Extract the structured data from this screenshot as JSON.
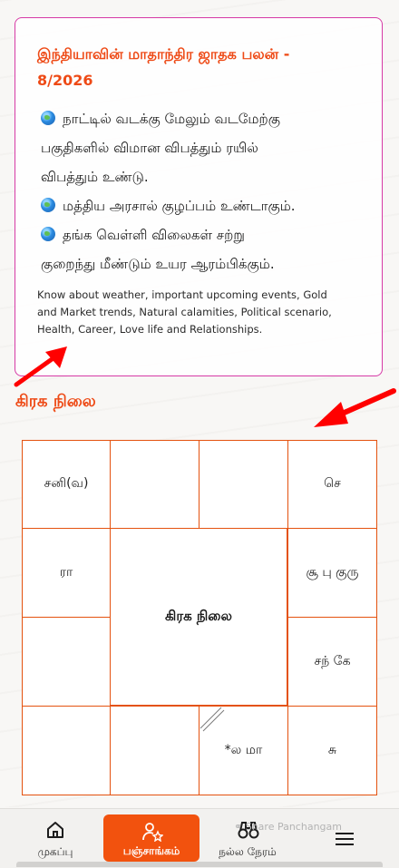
{
  "card": {
    "title_line1": "இந்தியாவின் மாதாந்திர ஜாதக பலன் -",
    "title_line2": "8/2026",
    "bullets": [
      {
        "icon": "globe-icon",
        "line1": "நாட்டில் வடக்கு மேலும் வடமேற்கு",
        "line2": "பகுதிகளில் விமான விபத்தும் ரயில்",
        "line3": "விபத்தும் உண்டு."
      },
      {
        "icon": "globe-icon",
        "line1": "மத்திய அரசால் குழப்பம் உண்டாகும்."
      },
      {
        "icon": "globe-icon",
        "line1": "தங்க வெள்ளி விலைகள் சற்று",
        "line2": "குறைந்து மீண்டும் உயர ஆரம்பிக்கும்."
      }
    ],
    "footer_line1": "Know about weather, important upcoming events, Gold",
    "footer_line2": "and Market trends, Natural calamities, Political scenario,",
    "footer_line3": "Health, Career, Love life and Relationships."
  },
  "section_title": "கிரக நிலை",
  "chart": {
    "center_label": "கிரக நிலை",
    "houses": {
      "top_left": "சனி(வ)",
      "top_2": "",
      "top_3": "",
      "top_right": "செ",
      "left_2": "ரா",
      "right_2": "சூ பு குரு",
      "left_3": "",
      "right_3": "சந் கே",
      "bottom_left": "",
      "bottom_2": "",
      "bottom_3": "*ல மா",
      "bottom_right": "சு"
    }
  },
  "nav": {
    "home": "முகப்பு",
    "panchangam": "பஞ்சாங்கம்",
    "good_time": "நல்ல நேரம்",
    "share": "Share Panchangam"
  },
  "colors": {
    "accent": "#f2520e",
    "title": "#ee4a16",
    "card_border": "#d63aa6",
    "arrow": "#ff0000"
  }
}
